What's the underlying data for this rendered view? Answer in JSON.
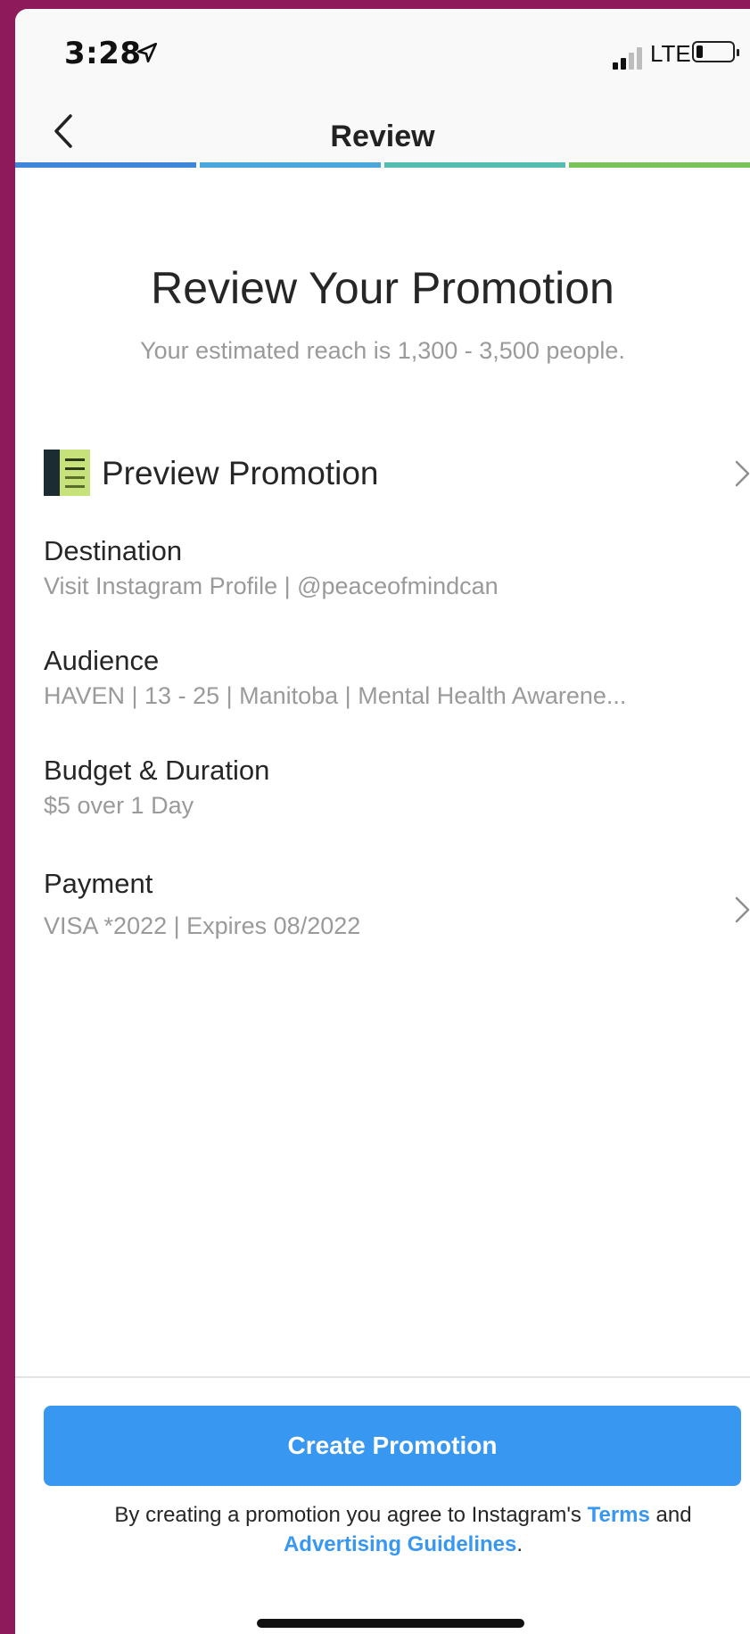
{
  "status_bar": {
    "time": "3:28",
    "network": "LTE"
  },
  "nav": {
    "title": "Review"
  },
  "progress_colors": [
    "#3f86d8",
    "#4ba7da",
    "#57bcb0",
    "#78c25a"
  ],
  "header": {
    "title": "Review Your Promotion",
    "subtitle": "Your estimated reach is 1,300 - 3,500 people."
  },
  "rows": {
    "preview": {
      "label": "Preview Promotion"
    },
    "destination": {
      "label": "Destination",
      "value": "Visit Instagram Profile | @peaceofmindcan"
    },
    "audience": {
      "label": "Audience",
      "value": "HAVEN | 13 - 25 | Manitoba | Mental Health Awarene..."
    },
    "budget": {
      "label": "Budget & Duration",
      "value": "$5 over 1 Day"
    },
    "payment": {
      "label": "Payment",
      "value": "VISA *2022 | Expires 08/2022"
    }
  },
  "cta": {
    "label": "Create Promotion"
  },
  "legal": {
    "prefix": "By creating a promotion you agree to Instagram's ",
    "terms": "Terms",
    "middle": " and",
    "guidelines": "Advertising Guidelines",
    "suffix": "."
  },
  "colors": {
    "accent": "#3897f0",
    "background": "#8e1a5c"
  }
}
